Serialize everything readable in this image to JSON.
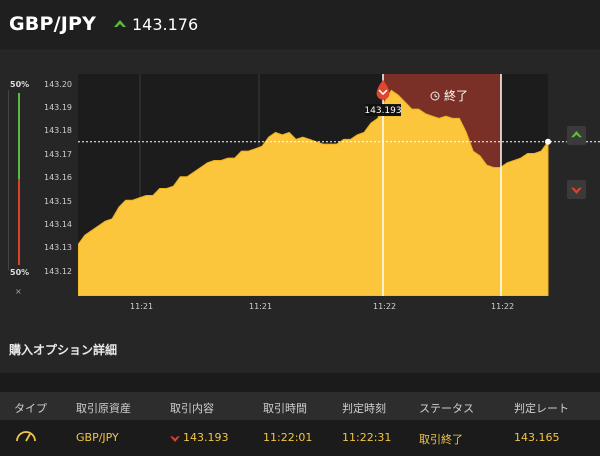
{
  "header": {
    "pair": "GBP/JPY",
    "live_rate": "143.176",
    "direction": "up"
  },
  "chart": {
    "y_ticks": [
      "143.20",
      "143.19",
      "143.18",
      "143.17",
      "143.16",
      "143.15",
      "143.14",
      "143.13",
      "143.12"
    ],
    "x_ticks": [
      "11:21",
      "11:21",
      "11:22",
      "11:22"
    ],
    "entry_label": "143.193",
    "end_label": "終了",
    "gauge_top": "50%",
    "gauge_bottom": "50%",
    "gauge_close": "×"
  },
  "chart_data": {
    "type": "area",
    "title": "",
    "xlabel": "",
    "ylabel": "",
    "x_ticks": [
      "11:21",
      "11:21",
      "11:22",
      "11:22"
    ],
    "y_range": [
      143.11,
      143.205
    ],
    "entry_rate": 143.193,
    "current_rate": 143.176,
    "series": [
      {
        "values": [
          143.132,
          143.136,
          143.138,
          143.14,
          143.142,
          143.143,
          143.148,
          143.151,
          143.151,
          143.152,
          143.153,
          143.153,
          143.156,
          143.156,
          143.157,
          143.161,
          143.161,
          143.163,
          143.165,
          143.167,
          143.168,
          143.168,
          143.169,
          143.169,
          143.172,
          143.172,
          143.173,
          143.174,
          143.178,
          143.18,
          143.179,
          143.18,
          143.177,
          143.178,
          143.177,
          143.176,
          143.175,
          143.175,
          143.175,
          143.177,
          143.177,
          143.179,
          143.18,
          143.184,
          143.186,
          143.193,
          143.198,
          143.196,
          143.193,
          143.19,
          143.19,
          143.188,
          143.187,
          143.186,
          143.187,
          143.186,
          143.186,
          143.18,
          143.172,
          143.17,
          143.166,
          143.165,
          143.165,
          143.167,
          143.168,
          143.169,
          143.171,
          143.171,
          143.172,
          143.176
        ]
      }
    ]
  },
  "section": {
    "title": "購入オプション詳細"
  },
  "table": {
    "headers": [
      "タイプ",
      "取引原資産",
      "取引内容",
      "取引時間",
      "判定時刻",
      "ステータス",
      "判定レート"
    ],
    "row": {
      "asset": "GBP/JPY",
      "rate": "143.193",
      "trade_time": "11:22:01",
      "judge_time": "11:22:31",
      "status": "取引終了",
      "judge_rate": "143.165"
    }
  },
  "colors": {
    "accent": "#f5c23d",
    "up": "#5dbb3a",
    "down": "#d9432e",
    "panel": "#262626"
  }
}
